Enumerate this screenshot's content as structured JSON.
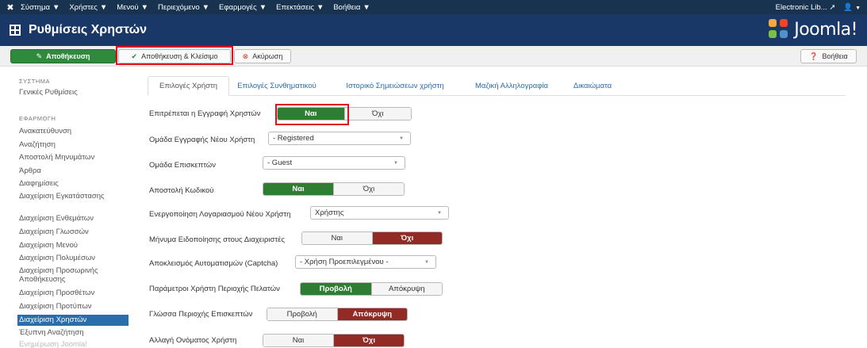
{
  "navbar": {
    "logo_icon": "joomla-icon",
    "menu": [
      "Σύστημα",
      "Χρήστες",
      "Μενού",
      "Περιεχόμενο",
      "Εφαρμογές",
      "Επεκτάσεις",
      "Βοήθεια"
    ],
    "site_name": "Electronic Lib...",
    "user_icon": "user-icon"
  },
  "header": {
    "title": "Ρυθμίσεις Χρηστών",
    "brand": "Joomla!"
  },
  "toolbar": {
    "save": "Αποθήκευση",
    "save_close": "Αποθήκευση & Κλείσιμο",
    "cancel": "Ακύρωση",
    "help": "Βοήθεια"
  },
  "sidebar": {
    "system_heading": "ΣΥΣΤΗΜΑ",
    "system_items": [
      "Γενικές Ρυθμίσεις"
    ],
    "apps_heading": "ΕΦΑΡΜΟΓΗ",
    "app_items": [
      "Ανακατεύθυνση",
      "Αναζήτηση",
      "Αποστολή Μηνυμάτων",
      "Άρθρα",
      "Διαφημίσεις",
      "Διαχείριση Εγκατάστασης",
      "Διαχείριση Ενθεμάτων",
      "Διαχείριση Γλωσσών",
      "Διαχείριση Μενού",
      "Διαχείριση Πολυμέσων",
      "Διαχείριση Προσωρινής Αποθήκευσης",
      "Διαχείριση Προσθέτων",
      "Διαχείριση Προτύπων",
      "Διαχείριση Χρηστών",
      "Έξυπνη Αναζήτηση",
      "Ενημέρωση Joomla!"
    ],
    "active_index": 13
  },
  "tabs": [
    "Επιλογές Χρήστη",
    "Επιλογές Συνθηματικού",
    "Ιστορικό Σημειώσεων χρήστη",
    "Μαζική Αλληλογραφία",
    "Δικαιώματα"
  ],
  "form": {
    "allow_registration": {
      "label": "Επιτρέπεται η Εγγραφή Χρηστών",
      "yes": "Ναι",
      "no": "Όχι",
      "value": "Ναι"
    },
    "new_user_group": {
      "label": "Ομάδα Εγγραφής Νέου Χρήστη",
      "value": "- Registered"
    },
    "guest_group": {
      "label": "Ομάδα Επισκεπτών",
      "value": "- Guest"
    },
    "send_password": {
      "label": "Αποστολή Κωδικού",
      "yes": "Ναι",
      "no": "Όχι",
      "value": "Ναι"
    },
    "account_activation": {
      "label": "Ενεργοποίηση Λογαριασμού Νέου Χρήστη",
      "value": "Χρήστης"
    },
    "notify_admins": {
      "label": "Μήνυμα Ειδοποίησης στους Διαχειριστές",
      "yes": "Ναι",
      "no": "Όχι",
      "value": "Όχι"
    },
    "captcha": {
      "label": "Αποκλεισμός Αυτοματισμών (Captcha)",
      "value": "- Χρήση Προεπιλεγμένου -"
    },
    "frontend_params": {
      "label": "Παράμετροι Χρήστη Περιοχής Πελατών",
      "show": "Προβολή",
      "hide": "Απόκρυψη",
      "value": "Προβολή"
    },
    "frontend_language": {
      "label": "Γλώσσα Περιοχής Επισκεπτών",
      "show": "Προβολή",
      "hide": "Απόκρυψη",
      "value": "Απόκρυψη"
    },
    "change_username": {
      "label": "Αλλαγή Ονόματος Χρήστη",
      "yes": "Ναι",
      "no": "Όχι",
      "value": "Όχι"
    }
  },
  "colors": {
    "navbar": "#17334f",
    "header": "#1a3867",
    "save_green": "#2f8a3d",
    "toggle_green": "#2f7d32",
    "toggle_red": "#922a26",
    "highlight_red": "#e0121b",
    "active_blue": "#2a6dad"
  }
}
